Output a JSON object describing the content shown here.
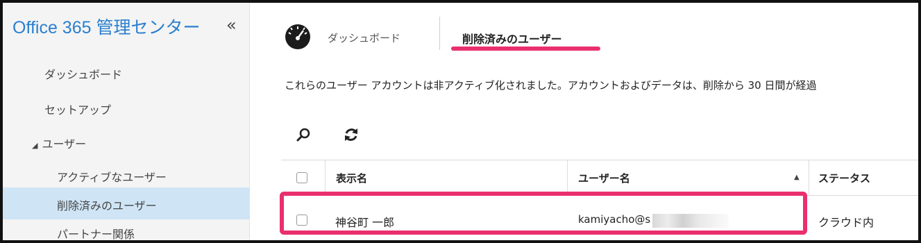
{
  "app": {
    "title": "Office 365 管理センター",
    "collapse_glyph": "«"
  },
  "sidebar": {
    "items": [
      {
        "label": "ダッシュボード"
      },
      {
        "label": "セットアップ"
      },
      {
        "label": "ユーザー"
      },
      {
        "label": "アクティブなユーザー"
      },
      {
        "label": "削除済みのユーザー",
        "selected": true
      },
      {
        "label": "パートナー関係"
      }
    ]
  },
  "breadcrumb": {
    "dashboard": "ダッシュボード",
    "current": "削除済みのユーザー"
  },
  "description": "これらのユーザー アカウントは非アクティブ化されました。アカウントおよびデータは、削除から 30 日間が経過",
  "toolbar": {
    "search_icon": "search-icon",
    "refresh_icon": "refresh-icon"
  },
  "table": {
    "headers": {
      "display_name": "表示名",
      "user_name": "ユーザー名",
      "status": "ステータス"
    },
    "sort": "ascending",
    "rows": [
      {
        "display_name": "神谷町 一郎",
        "user_name": "kamiyacho@s",
        "status": "クラウド内"
      }
    ]
  },
  "colors": {
    "accent": "#2a7fcf",
    "highlight": "#ea2f6d",
    "selected_bg": "#cfe5f6"
  }
}
